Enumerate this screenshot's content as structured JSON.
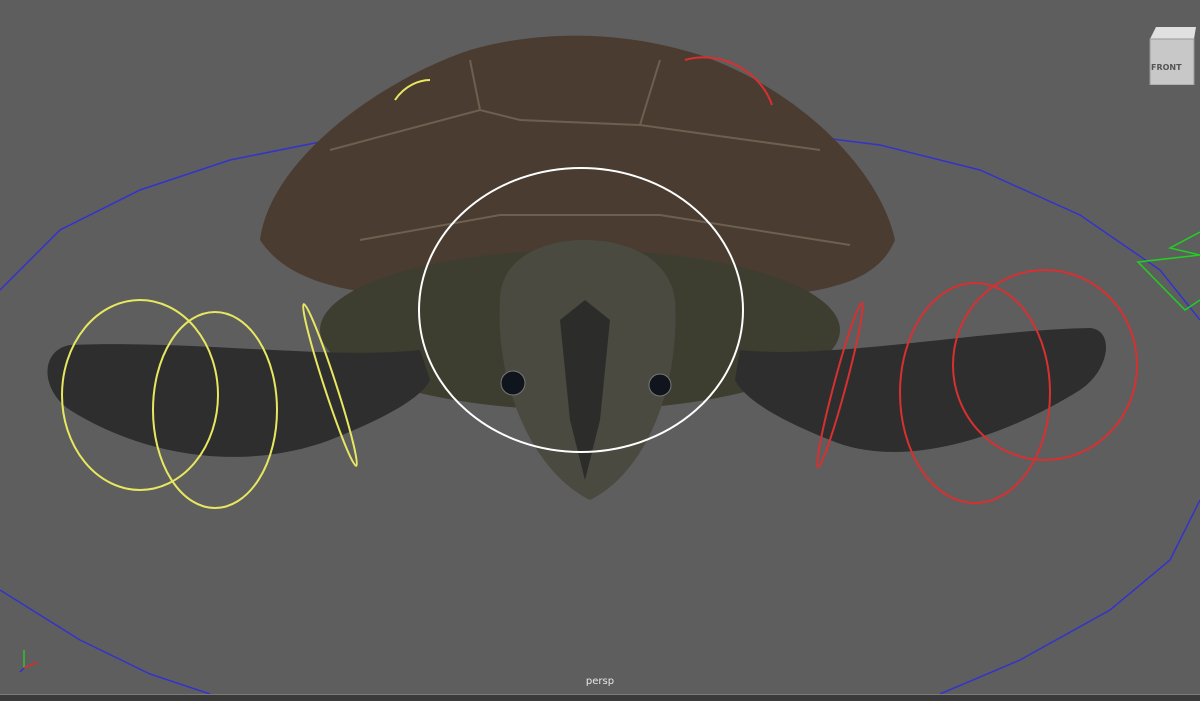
{
  "viewport": {
    "camera_label": "persp",
    "viewcube": {
      "face": "FRONT"
    },
    "axis_indicator": {
      "axes": [
        "x",
        "y",
        "z"
      ],
      "colors": {
        "x": "#d03030",
        "y": "#30c030",
        "z": "#3030d0"
      }
    },
    "scene_object": "sea-turtle-model",
    "control_colors": {
      "left_flipper": "#e8e860",
      "right_flipper": "#d83030",
      "head": "#ffffff",
      "root": "#3030c8",
      "extra": "#20d020"
    },
    "background": "#5e5e5e"
  }
}
